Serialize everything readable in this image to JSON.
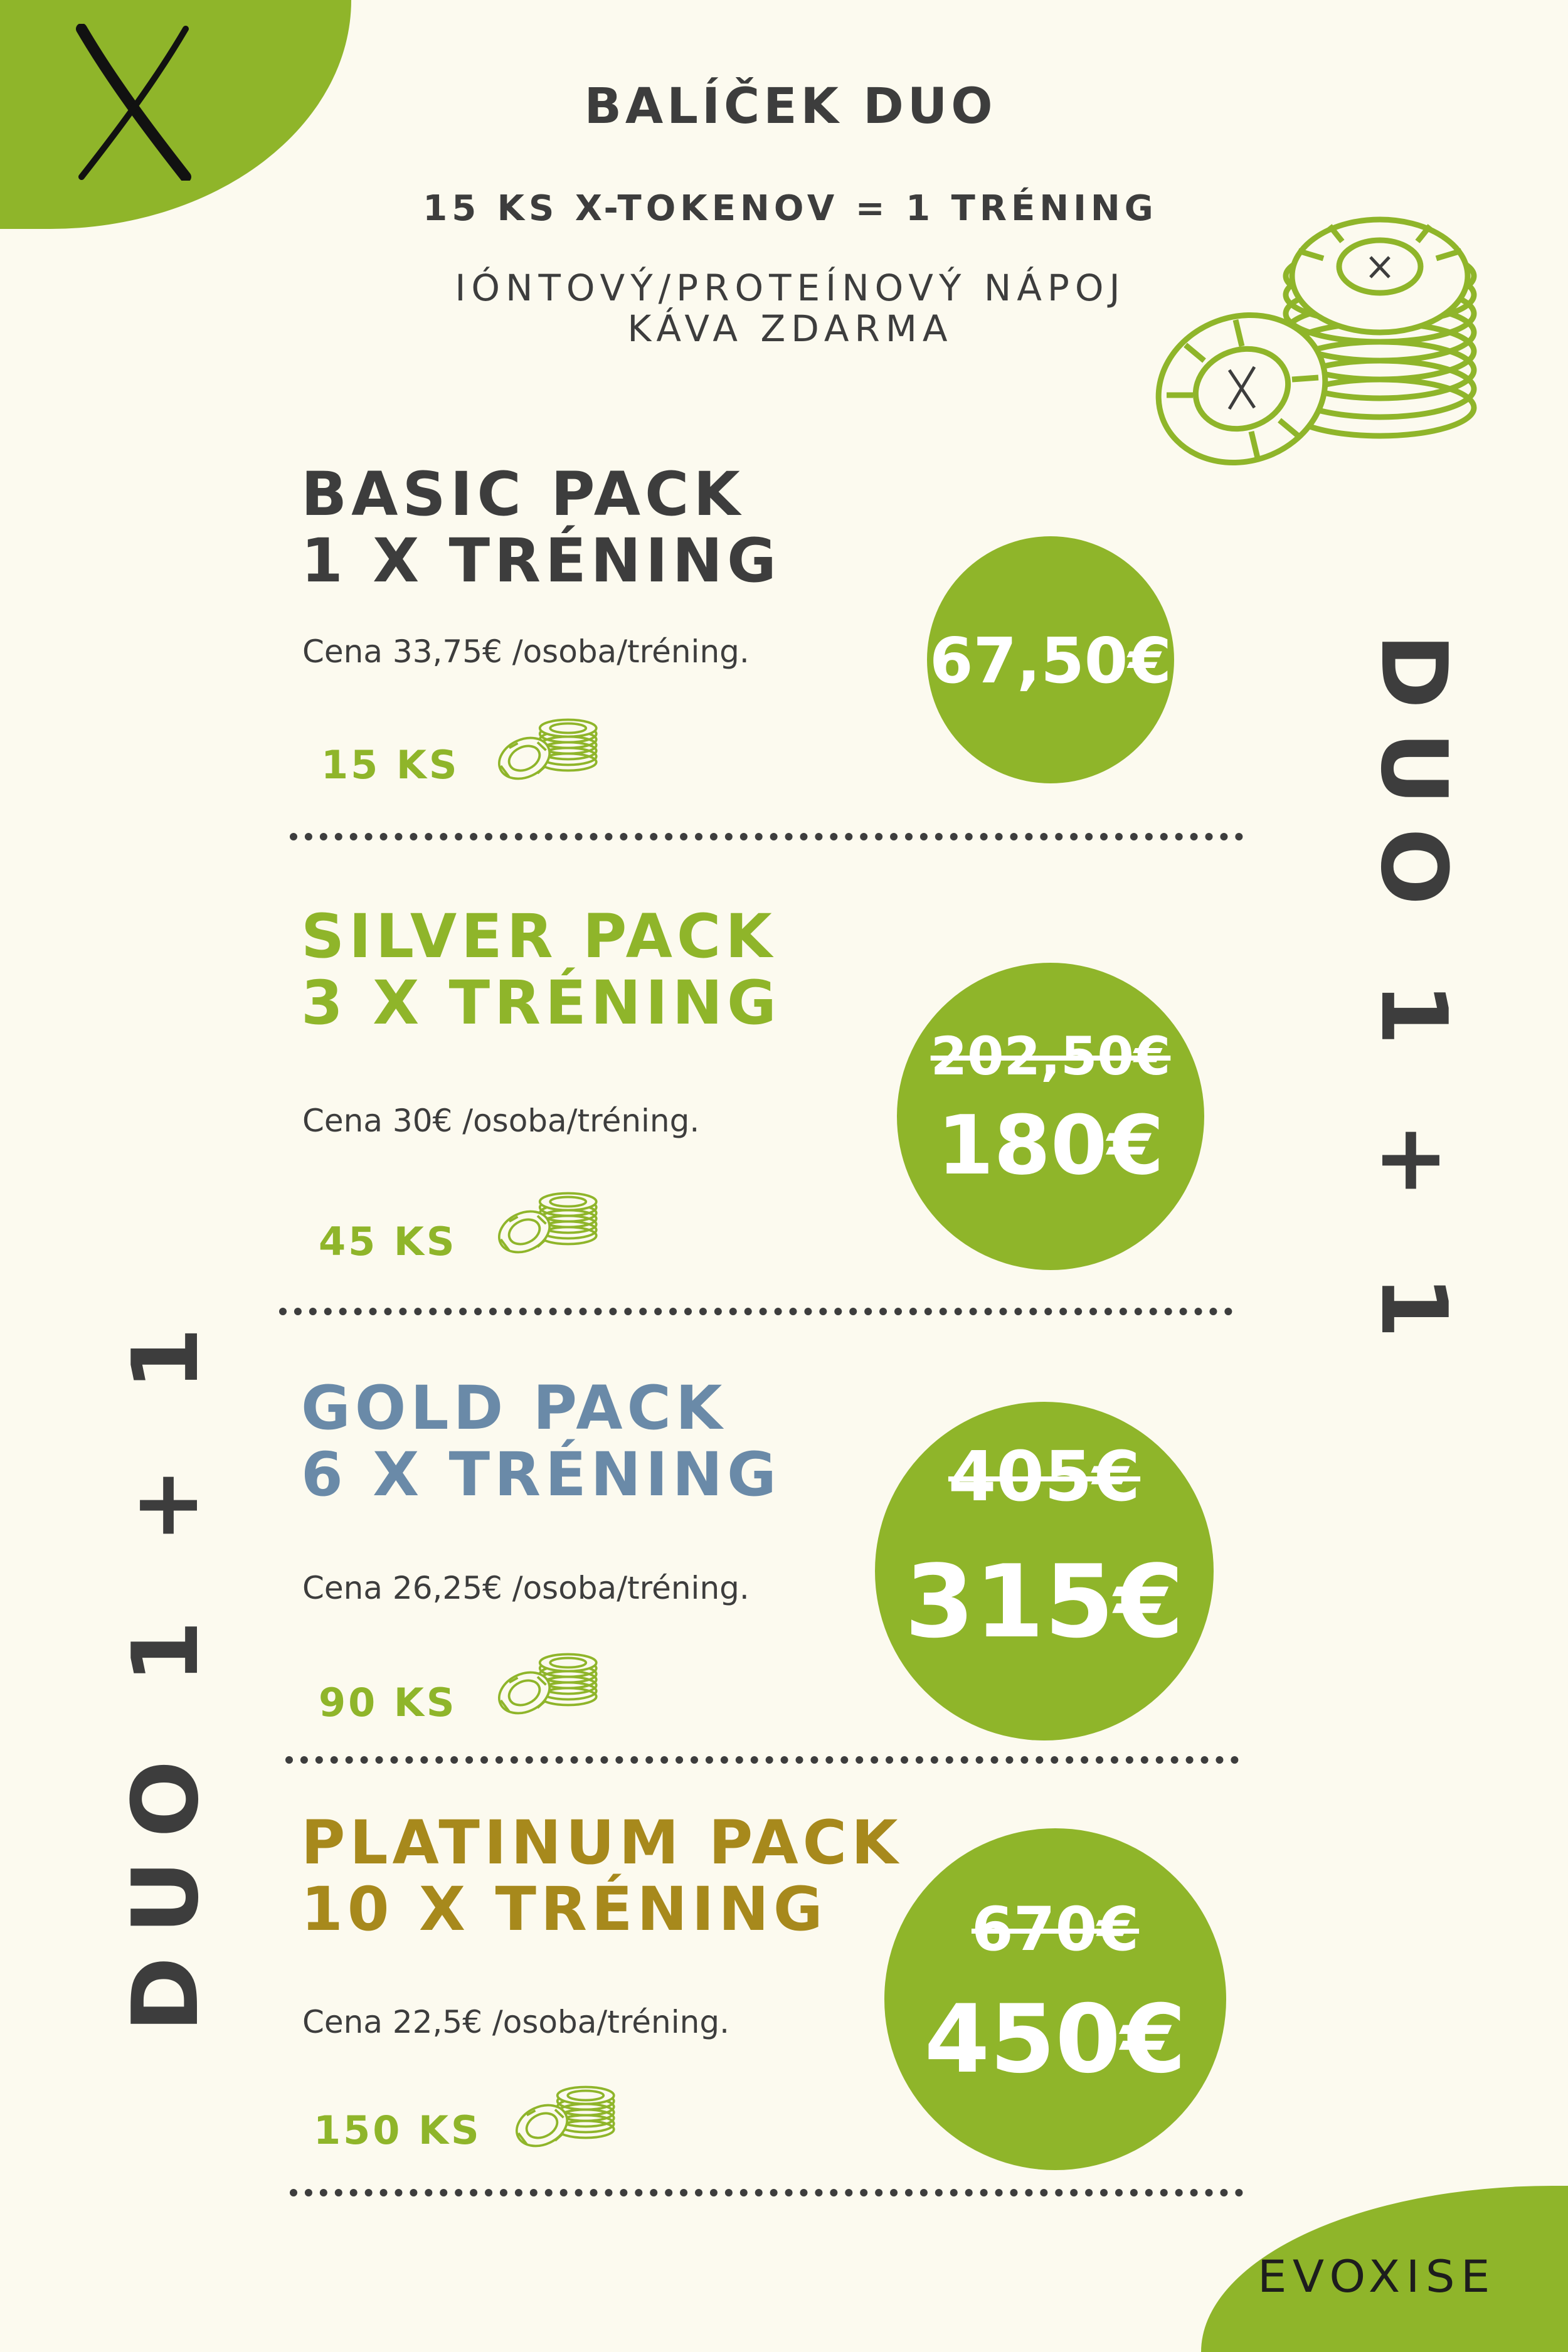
{
  "brand": {
    "corner_letter": "X",
    "logo_text": "EVOXISE",
    "accent_color": "#8fb52a"
  },
  "header": {
    "title": "BALÍČEK DUO",
    "subtitle": "15 KS X-TOKENOV = 1 TRÉNING",
    "line1": "IÓNTOVÝ/PROTEÍNOVÝ NÁPOJ",
    "line2": "KÁVA ZDARMA",
    "coins_icon": "coin-stack-icon"
  },
  "side_label": "DUO 1 + 1",
  "packs": [
    {
      "name": "BASIC PACK",
      "sessions": "1 X TRÉNING",
      "color": "#3d3d3d",
      "price_note": "Cena 33,75€ /osoba/tréning.",
      "tokens": "15 KS",
      "old_price": "",
      "price": "67,50€"
    },
    {
      "name": "SILVER PACK",
      "sessions": "3 X TRÉNING",
      "color": "#8fb52a",
      "price_note": "Cena 30€ /osoba/tréning.",
      "tokens": "45 KS",
      "old_price": "202,50€",
      "price": "180€"
    },
    {
      "name": "GOLD PACK",
      "sessions": "6 X TRÉNING",
      "color": "#6a8aa8",
      "price_note": "Cena 26,25€ /osoba/tréning.",
      "tokens": "90 KS",
      "old_price": "405€",
      "price": "315€"
    },
    {
      "name": "PLATINUM PACK",
      "sessions": "10 X TRÉNING",
      "color": "#a7891c",
      "price_note": "Cena 22,5€ /osoba/tréning.",
      "tokens": "150 KS",
      "old_price": "670€",
      "price": "450€"
    }
  ]
}
